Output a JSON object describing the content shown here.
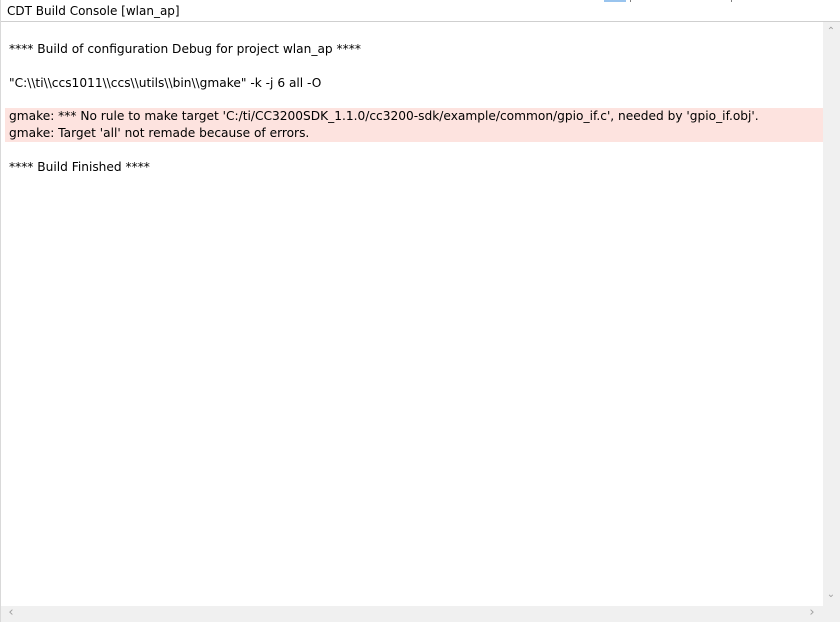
{
  "window": {
    "title": "CDT Build Console [wlan_ap]"
  },
  "console": {
    "lines": [
      "**** Build of configuration Debug for project wlan_ap ****",
      "",
      "\"C:\\\\ti\\\\ccs1011\\\\ccs\\\\utils\\\\bin\\\\gmake\" -k -j 6 all -O",
      "",
      "gmake: *** No rule to make target 'C:/ti/CC3200SDK_1.1.0/cc3200-sdk/example/common/gpio_if.c', needed by 'gpio_if.obj'.",
      "gmake: Target 'all' not remade because of errors.",
      "",
      "**** Build Finished ****"
    ],
    "error_highlight_color": "#fde3df"
  },
  "scrollbars": {
    "up_icon": "chevron-up-icon",
    "down_icon": "chevron-down-icon",
    "left_icon": "chevron-left-icon",
    "right_icon": "chevron-right-icon"
  }
}
